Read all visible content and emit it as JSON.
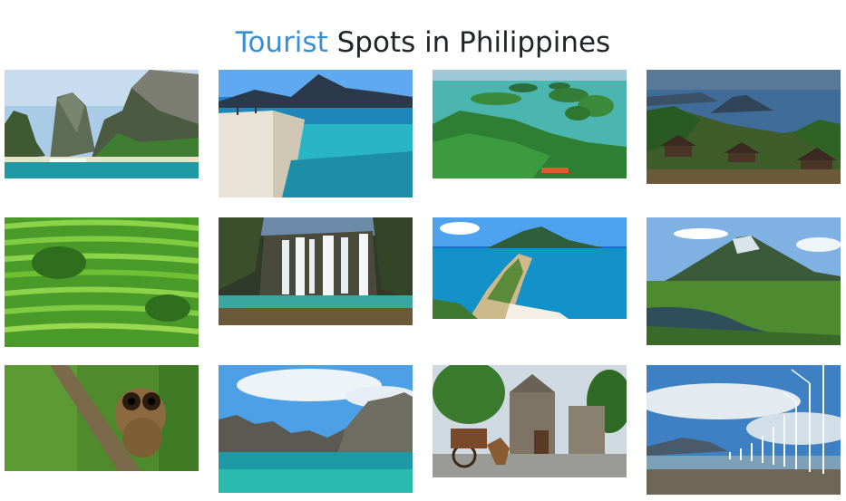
{
  "page": {
    "title_accent": "Tourist",
    "title_rest": " Spots in Philippines",
    "accent_color": "#3a8fd4"
  },
  "gallery": {
    "images": [
      {
        "subject": "limestone cliffs lagoon"
      },
      {
        "subject": "white sand beach and volcano"
      },
      {
        "subject": "islands in turquoise sea"
      },
      {
        "subject": "lake volcano with resort huts"
      },
      {
        "subject": "rice terraces"
      },
      {
        "subject": "waterfalls"
      },
      {
        "subject": "island sandbar"
      },
      {
        "subject": "cone volcano"
      },
      {
        "subject": "tarsier on branch"
      },
      {
        "subject": "karst islands lagoon"
      },
      {
        "subject": "stone church and horse carriage"
      },
      {
        "subject": "wind turbines on shore"
      }
    ]
  }
}
